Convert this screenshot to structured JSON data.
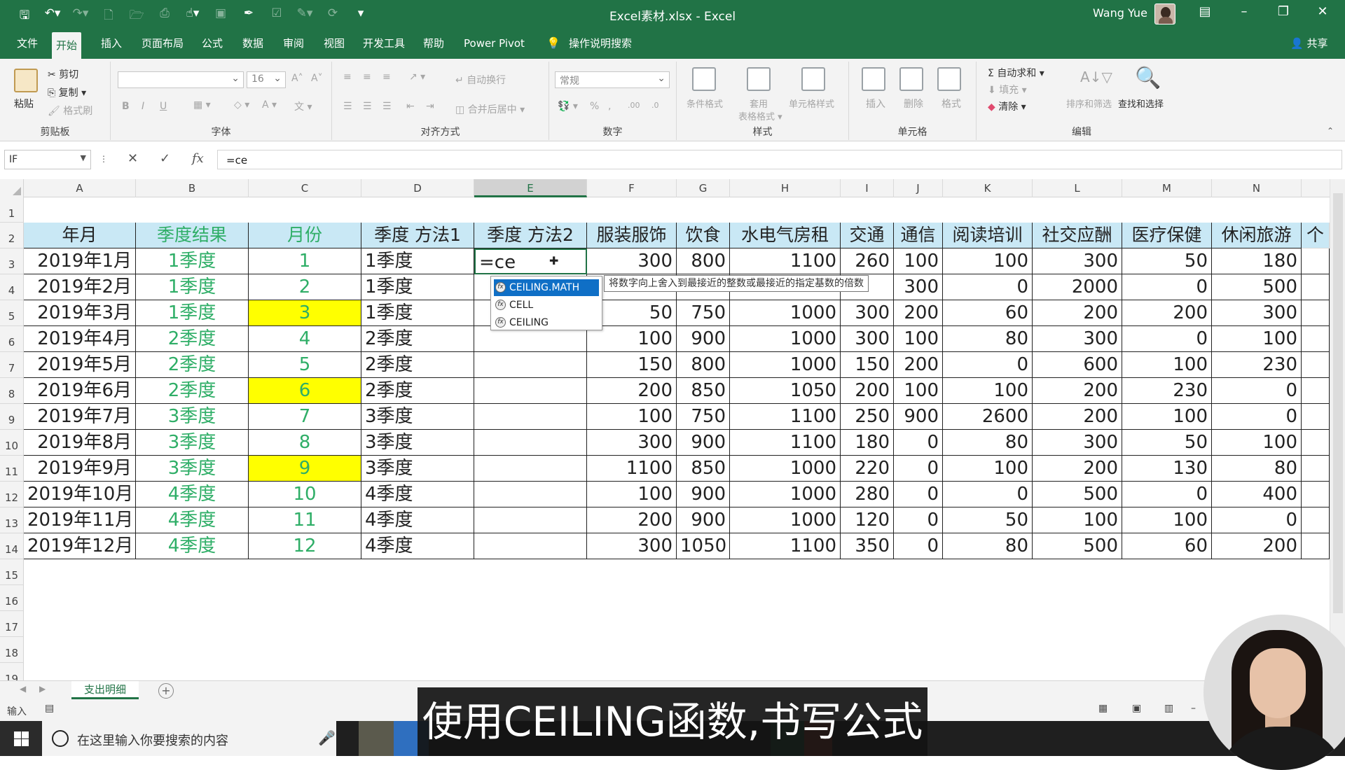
{
  "titlebar": {
    "document_title": "Excel素材.xlsx  -  Excel",
    "user_name": "Wang Yue",
    "buttons": [
      "restore-ribbon",
      "minimize",
      "maximize",
      "close"
    ]
  },
  "menu": {
    "tabs": [
      "文件",
      "开始",
      "插入",
      "页面布局",
      "公式",
      "数据",
      "审阅",
      "视图",
      "开发工具",
      "帮助",
      "Power Pivot",
      "操作说明搜索"
    ],
    "active_tab": "开始",
    "share": "共享"
  },
  "ribbon": {
    "clipboard": {
      "label": "剪贴板",
      "paste": "粘贴",
      "cut": "剪切",
      "copy": "复制",
      "format_painter": "格式刷"
    },
    "font": {
      "label": "字体",
      "font_size": "16",
      "bold": "B",
      "italic": "I",
      "underline": "U"
    },
    "alignment": {
      "label": "对齐方式",
      "wrap": "自动换行",
      "merge": "合并后居中"
    },
    "number": {
      "label": "数字",
      "format": "常规"
    },
    "styles": {
      "label": "样式",
      "conditional": "条件格式",
      "table": "套用\n表格格式",
      "cell_styles": "单元格样式"
    },
    "cells": {
      "label": "单元格",
      "insert": "插入",
      "delete": "删除",
      "format": "格式"
    },
    "editing": {
      "label": "编辑",
      "autosum": "自动求和",
      "fill": "填充",
      "clear": "清除",
      "sort": "排序和筛选",
      "find": "查找和选择"
    }
  },
  "formula_bar": {
    "name_box": "IF",
    "formula": "=ce"
  },
  "columns": [
    "A",
    "B",
    "C",
    "D",
    "E",
    "F",
    "G",
    "H",
    "I",
    "J",
    "K",
    "L",
    "M",
    "N"
  ],
  "rows": [
    "1",
    "2",
    "3",
    "4",
    "5",
    "6",
    "7",
    "8",
    "9",
    "10",
    "11",
    "12",
    "13",
    "14",
    "15",
    "16",
    "17",
    "18",
    "19"
  ],
  "table": {
    "headers": [
      "年月",
      "季度结果",
      "月份",
      "季度 方法1",
      "季度 方法2",
      "服装服饰",
      "饮食",
      "水电气房租",
      "交通",
      "通信",
      "阅读培训",
      "社交应酬",
      "医疗保健",
      "休闲旅游",
      "个"
    ],
    "rows": [
      [
        "2019年1月",
        "1季度",
        "1",
        "1季度",
        "=ce",
        "300",
        "800",
        "1100",
        "260",
        "100",
        "100",
        "300",
        "50",
        "180"
      ],
      [
        "2019年2月",
        "1季度",
        "2",
        "1季度",
        "",
        "",
        "",
        "",
        "",
        "300",
        "0",
        "2000",
        "0",
        "500"
      ],
      [
        "2019年3月",
        "1季度",
        "3",
        "1季度",
        "",
        "50",
        "750",
        "1000",
        "300",
        "200",
        "60",
        "200",
        "200",
        "300"
      ],
      [
        "2019年4月",
        "2季度",
        "4",
        "2季度",
        "",
        "100",
        "900",
        "1000",
        "300",
        "100",
        "80",
        "300",
        "0",
        "100"
      ],
      [
        "2019年5月",
        "2季度",
        "5",
        "2季度",
        "",
        "150",
        "800",
        "1000",
        "150",
        "200",
        "0",
        "600",
        "100",
        "230"
      ],
      [
        "2019年6月",
        "2季度",
        "6",
        "2季度",
        "",
        "200",
        "850",
        "1050",
        "200",
        "100",
        "100",
        "200",
        "230",
        "0"
      ],
      [
        "2019年7月",
        "3季度",
        "7",
        "3季度",
        "",
        "100",
        "750",
        "1100",
        "250",
        "900",
        "2600",
        "200",
        "100",
        "0"
      ],
      [
        "2019年8月",
        "3季度",
        "8",
        "3季度",
        "",
        "300",
        "900",
        "1100",
        "180",
        "0",
        "80",
        "300",
        "50",
        "100"
      ],
      [
        "2019年9月",
        "3季度",
        "9",
        "3季度",
        "",
        "1100",
        "850",
        "1000",
        "220",
        "0",
        "100",
        "200",
        "130",
        "80"
      ],
      [
        "2019年10月",
        "4季度",
        "10",
        "4季度",
        "",
        "100",
        "900",
        "1000",
        "280",
        "0",
        "0",
        "500",
        "0",
        "400"
      ],
      [
        "2019年11月",
        "4季度",
        "11",
        "4季度",
        "",
        "200",
        "900",
        "1000",
        "120",
        "0",
        "50",
        "100",
        "100",
        "0"
      ],
      [
        "2019年12月",
        "4季度",
        "12",
        "4季度",
        "",
        "300",
        "1050",
        "1100",
        "350",
        "0",
        "80",
        "500",
        "60",
        "200"
      ]
    ],
    "yellow_month_rows": [
      3,
      6,
      9
    ],
    "header_fill": "#c9e8f5",
    "green_text": "#2fae67",
    "highlight": "#ffff00"
  },
  "autocomplete": {
    "items": [
      "CEILING.MATH",
      "CELL",
      "CEILING"
    ],
    "selected": "CEILING.MATH",
    "tooltip": "将数字向上舍入到最接近的整数或最接近的指定基数的倍数"
  },
  "sheet_tabs": [
    "支出明细"
  ],
  "status": {
    "mode": "输入"
  },
  "taskbar": {
    "search_placeholder": "在这里输入你要搜索的内容"
  },
  "subtitle": "使用CEILING函数,书写公式",
  "colors": {
    "excel_green": "#217346",
    "selection_blue": "#0f6fc6"
  }
}
